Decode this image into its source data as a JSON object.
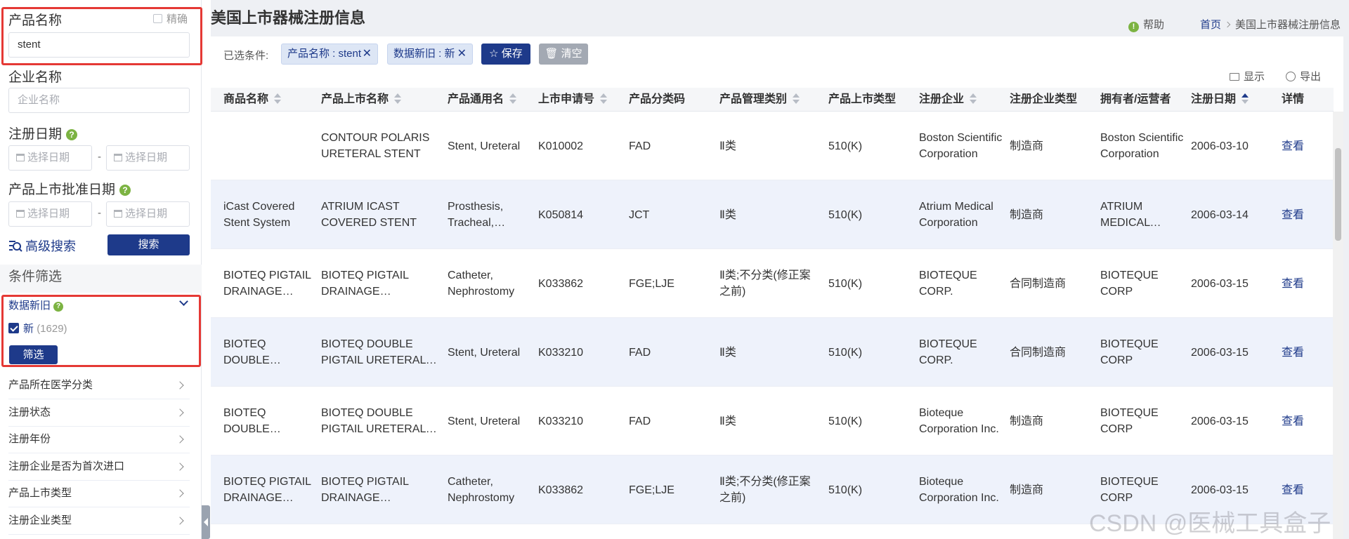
{
  "sidebar": {
    "product_name_label": "产品名称",
    "exact_label": "精确",
    "product_name_value": "stent",
    "company_name_label": "企业名称",
    "company_name_placeholder": "企业名称",
    "reg_date_label": "注册日期",
    "market_date_label": "产品上市批准日期",
    "date_placeholder": "选择日期",
    "date_separator": "-",
    "advanced_search": "高级搜索",
    "search_button": "搜索",
    "filter_header": "条件筛选",
    "facet_data_freshness": "数据新旧",
    "facet_option_new": "新",
    "facet_option_new_count": "(1629)",
    "filter_button": "筛选",
    "facets": [
      "产品所在医学分类",
      "注册状态",
      "注册年份",
      "注册企业是否为首次进口",
      "产品上市类型",
      "注册企业类型"
    ]
  },
  "header": {
    "page_title": "美国上市器械注册信息",
    "help": "帮助",
    "breadcrumb_home": "首页",
    "breadcrumb_current": "美国上市器械注册信息"
  },
  "toolbar": {
    "selected_conditions_label": "已选条件:",
    "tag_product_name": "产品名称 : stent",
    "tag_data_freshness": "数据新旧 : 新",
    "save": "保存",
    "clear": "清空",
    "display": "显示",
    "export": "导出"
  },
  "table": {
    "columns": [
      "商品名称",
      "产品上市名称",
      "产品通用名",
      "上市申请号",
      "产品分类码",
      "产品管理类别",
      "产品上市类型",
      "注册企业",
      "注册企业类型",
      "拥有者/运营者",
      "注册日期",
      "详情"
    ],
    "rows": [
      {
        "trade": "",
        "market_name": "CONTOUR POLARIS URETERAL STENT",
        "generic": "Stent, Ureteral",
        "app_no": "K010002",
        "code": "FAD",
        "mgmt": "Ⅱ类",
        "type": "510(K)",
        "company": "Boston Scientific Corporation",
        "company_type": "制造商",
        "owner": "Boston Scientific Corporation",
        "date": "2006-03-10",
        "detail": "查看"
      },
      {
        "trade": "iCast Covered Stent System",
        "market_name": "ATRIUM ICAST COVERED STENT",
        "generic": "Prosthesis, Tracheal, Expandable",
        "app_no": "K050814",
        "code": "JCT",
        "mgmt": "Ⅱ类",
        "type": "510(K)",
        "company": "Atrium Medical Corporation",
        "company_type": "制造商",
        "owner": "ATRIUM MEDICAL CORPORATION",
        "date": "2006-03-14",
        "detail": "查看"
      },
      {
        "trade": "BIOTEQ PIGTAIL DRAINAGE CATHETER",
        "market_name": "BIOTEQ PIGTAIL DRAINAGE CATHETER",
        "generic": "Catheter, Nephrostomy",
        "app_no": "K033862",
        "code": "FGE;LJE",
        "mgmt": "Ⅱ类;不分类(修正案之前)",
        "type": "510(K)",
        "company": "BIOTEQUE CORP.",
        "company_type": "合同制造商",
        "owner": "BIOTEQUE CORP",
        "date": "2006-03-15",
        "detail": "查看"
      },
      {
        "trade": "BIOTEQ DOUBLE PIGTAIL URETERAL STENT",
        "market_name": "BIOTEQ DOUBLE PIGTAIL URETERAL STENT",
        "generic": "Stent, Ureteral",
        "app_no": "K033210",
        "code": "FAD",
        "mgmt": "Ⅱ类",
        "type": "510(K)",
        "company": "BIOTEQUE CORP.",
        "company_type": "合同制造商",
        "owner": "BIOTEQUE CORP",
        "date": "2006-03-15",
        "detail": "查看"
      },
      {
        "trade": "BIOTEQ DOUBLE PIGTAIL URETERAL STENT",
        "market_name": "BIOTEQ DOUBLE PIGTAIL URETERAL STENT",
        "generic": "Stent, Ureteral",
        "app_no": "K033210",
        "code": "FAD",
        "mgmt": "Ⅱ类",
        "type": "510(K)",
        "company": "Bioteque Corporation Inc.",
        "company_type": "制造商",
        "owner": "BIOTEQUE CORP",
        "date": "2006-03-15",
        "detail": "查看"
      },
      {
        "trade": "BIOTEQ PIGTAIL DRAINAGE CATHETER",
        "market_name": "BIOTEQ PIGTAIL DRAINAGE CATHETER",
        "generic": "Catheter, Nephrostomy",
        "app_no": "K033862",
        "code": "FGE;LJE",
        "mgmt": "Ⅱ类;不分类(修正案之前)",
        "type": "510(K)",
        "company": "Bioteque Corporation Inc.",
        "company_type": "制造商",
        "owner": "BIOTEQUE CORP",
        "date": "2006-03-15",
        "detail": "查看"
      }
    ]
  },
  "watermark": "CSDN @医械工具盒子",
  "colors": {
    "primary": "#1e3a8a",
    "highlight_box": "#e53935",
    "help_green": "#7cb342"
  }
}
